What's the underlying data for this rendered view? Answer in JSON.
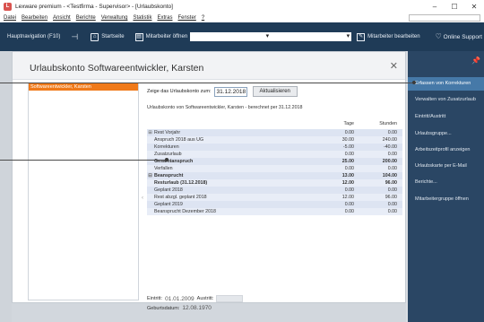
{
  "window": {
    "title": "Lexware premium - <Testfirma - Supervisor> - [Urlaubskonto]",
    "controls": [
      "–",
      "☐",
      "✕"
    ]
  },
  "menu": {
    "items": [
      "Datei",
      "Bearbeiten",
      "Ansicht",
      "Berichte",
      "Verwaltung",
      "Statistik",
      "Extras",
      "Fenster",
      "?"
    ]
  },
  "toolbar": {
    "navigation": "Hauptnavigation (F10)",
    "startseite": "Startseite",
    "open_employee": "Mitarbeiter öffnen",
    "edit_employee": "Mitarbeiter bearbeiten",
    "support": "Online Support"
  },
  "dialog": {
    "title": "Urlaubskonto  Softwareentwickler, Karsten",
    "employee": "Softwareentwickler, Karsten",
    "date_label": "Zeige das Urlaubskonto zum:",
    "date_value": "31.12.2018",
    "refresh_button": "Aktualisieren",
    "subtitle": "Urlaubskonto von Softwareentwickler, Karsten - berechnet per 31.12.2018",
    "columns": {
      "days": "Tage",
      "hours": "Stunden"
    },
    "rows": [
      {
        "exp": "⊞",
        "label": "Rest Vorjahr",
        "days": "0.00",
        "hours": "0.00",
        "bold": false
      },
      {
        "exp": "",
        "label": "Anspruch 2018 aus UG",
        "days": "30.00",
        "hours": "240.00",
        "bold": false
      },
      {
        "exp": "",
        "label": "Korrekturen",
        "days": "-5.00",
        "hours": "-40.00",
        "bold": false
      },
      {
        "exp": "",
        "label": "Zusatzurlaub",
        "days": "0.00",
        "hours": "0.00",
        "bold": false
      },
      {
        "exp": "",
        "label": "Gesamtanspruch",
        "days": "25.00",
        "hours": "200.00",
        "bold": true
      },
      {
        "exp": "",
        "label": "Verfallen",
        "days": "0.00",
        "hours": "0.00",
        "bold": false
      },
      {
        "exp": "⊟",
        "label": "Beansprucht",
        "days": "13.00",
        "hours": "104.00",
        "bold": true
      },
      {
        "exp": "",
        "label": "Resturlaub (31.12.2018)",
        "days": "12.00",
        "hours": "96.00",
        "bold": true
      },
      {
        "exp": "",
        "label": "Geplant 2018",
        "days": "0.00",
        "hours": "0.00",
        "bold": false
      },
      {
        "exp": "",
        "label": "Rest abzgl. geplant 2018",
        "days": "12.00",
        "hours": "96.00",
        "bold": false
      },
      {
        "exp": "",
        "label": "Geplant 2019",
        "days": "0.00",
        "hours": "0.00",
        "bold": false
      },
      {
        "exp": "",
        "label": "Beansprucht Dezember 2018",
        "days": "0.00",
        "hours": "0.00",
        "bold": false
      }
    ],
    "entry_label": "Eintritt:",
    "entry_value": "01.01.2009",
    "exit_label": "Austritt:",
    "birth_label": "Geburtsdatum:",
    "birth_value": "12.08.1970",
    "close": "✕"
  },
  "sidebar": {
    "pin": "📌",
    "items": [
      "Erfassen von Korrekturen",
      "Verwalten von Zusatzurlaub",
      "Eintritt/Austritt",
      "Urlaubsgruppe...",
      "Arbeitszeitprofil anzeigen",
      "Urlaubskarte per E-Mail",
      "Berichte...",
      "Mitarbeitergruppe öffnen"
    ]
  }
}
